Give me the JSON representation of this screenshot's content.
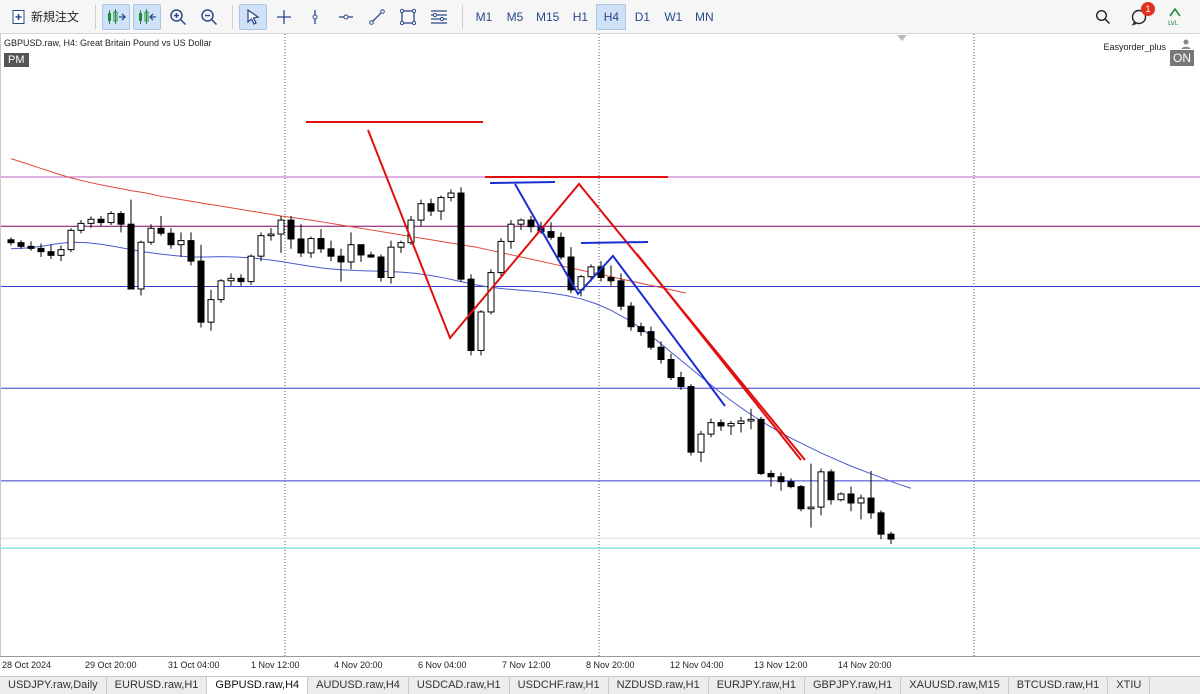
{
  "toolbar": {
    "new_order_label": "新規注文",
    "timeframes": [
      "M1",
      "M5",
      "M15",
      "H1",
      "H4",
      "D1",
      "W1",
      "MN"
    ],
    "active_timeframe": "H4",
    "notification_count": "1"
  },
  "chart": {
    "title": "GBPUSD.raw, H4:  Great Britain Pound vs US Dollar",
    "session_label": "PM",
    "ea_name": "Easyorder_plus",
    "ea_status": "ON",
    "ea_icon_text": "LVL"
  },
  "chart_data": {
    "type": "candlestick",
    "symbol": "GBPUSD.raw",
    "timeframe": "H4",
    "x_tick_labels": [
      "28 Oct 2024",
      "29 Oct 20:00",
      "31 Oct 04:00",
      "1 Nov 12:00",
      "4 Nov 20:00",
      "6 Nov 04:00",
      "7 Nov 12:00",
      "8 Nov 20:00",
      "12 Nov 04:00",
      "13 Nov 12:00",
      "14 Nov 20:00"
    ],
    "candles": [
      [
        0.742,
        0.748,
        0.728,
        0.735
      ],
      [
        0.735,
        0.741,
        0.72,
        0.726
      ],
      [
        0.726,
        0.738,
        0.715,
        0.721
      ],
      [
        0.721,
        0.733,
        0.7,
        0.713
      ],
      [
        0.713,
        0.73,
        0.695,
        0.704
      ],
      [
        0.704,
        0.728,
        0.69,
        0.718
      ],
      [
        0.718,
        0.77,
        0.712,
        0.765
      ],
      [
        0.765,
        0.79,
        0.758,
        0.782
      ],
      [
        0.782,
        0.799,
        0.771,
        0.792
      ],
      [
        0.792,
        0.8,
        0.775,
        0.784
      ],
      [
        0.784,
        0.812,
        0.778,
        0.806
      ],
      [
        0.806,
        0.812,
        0.76,
        0.78
      ],
      [
        0.78,
        0.84,
        0.622,
        0.622
      ],
      [
        0.622,
        0.74,
        0.606,
        0.736
      ],
      [
        0.736,
        0.78,
        0.73,
        0.77
      ],
      [
        0.77,
        0.8,
        0.752,
        0.758
      ],
      [
        0.758,
        0.77,
        0.72,
        0.73
      ],
      [
        0.73,
        0.76,
        0.7,
        0.74
      ],
      [
        0.74,
        0.76,
        0.68,
        0.69
      ],
      [
        0.69,
        0.73,
        0.528,
        0.541
      ],
      [
        0.541,
        0.62,
        0.52,
        0.596
      ],
      [
        0.596,
        0.646,
        0.588,
        0.642
      ],
      [
        0.642,
        0.66,
        0.63,
        0.648
      ],
      [
        0.648,
        0.658,
        0.63,
        0.64
      ],
      [
        0.64,
        0.706,
        0.632,
        0.702
      ],
      [
        0.702,
        0.76,
        0.69,
        0.752
      ],
      [
        0.752,
        0.77,
        0.74,
        0.756
      ],
      [
        0.756,
        0.8,
        0.71,
        0.79
      ],
      [
        0.79,
        0.8,
        0.72,
        0.744
      ],
      [
        0.744,
        0.78,
        0.7,
        0.71
      ],
      [
        0.71,
        0.75,
        0.698,
        0.745
      ],
      [
        0.745,
        0.768,
        0.71,
        0.72
      ],
      [
        0.72,
        0.74,
        0.69,
        0.702
      ],
      [
        0.702,
        0.72,
        0.64,
        0.688
      ],
      [
        0.688,
        0.76,
        0.67,
        0.73
      ],
      [
        0.73,
        0.73,
        0.688,
        0.705
      ],
      [
        0.705,
        0.713,
        0.698,
        0.7
      ],
      [
        0.7,
        0.706,
        0.64,
        0.65
      ],
      [
        0.65,
        0.74,
        0.635,
        0.724
      ],
      [
        0.724,
        0.74,
        0.71,
        0.735
      ],
      [
        0.735,
        0.8,
        0.73,
        0.79
      ],
      [
        0.79,
        0.84,
        0.775,
        0.83
      ],
      [
        0.83,
        0.842,
        0.8,
        0.812
      ],
      [
        0.812,
        0.85,
        0.79,
        0.845
      ],
      [
        0.845,
        0.865,
        0.836,
        0.856
      ],
      [
        0.856,
        0.87,
        0.64,
        0.646
      ],
      [
        0.646,
        0.658,
        0.46,
        0.472
      ],
      [
        0.472,
        0.57,
        0.46,
        0.566
      ],
      [
        0.566,
        0.67,
        0.56,
        0.662
      ],
      [
        0.662,
        0.746,
        0.65,
        0.738
      ],
      [
        0.738,
        0.79,
        0.72,
        0.78
      ],
      [
        0.78,
        0.794,
        0.766,
        0.79
      ],
      [
        0.79,
        0.8,
        0.76,
        0.774
      ],
      [
        0.774,
        0.786,
        0.756,
        0.762
      ],
      [
        0.762,
        0.785,
        0.742,
        0.748
      ],
      [
        0.748,
        0.76,
        0.694,
        0.7
      ],
      [
        0.7,
        0.724,
        0.612,
        0.62
      ],
      [
        0.62,
        0.656,
        0.604,
        0.652
      ],
      [
        0.652,
        0.682,
        0.64,
        0.676
      ],
      [
        0.676,
        0.69,
        0.64,
        0.65
      ],
      [
        0.65,
        0.68,
        0.63,
        0.642
      ],
      [
        0.642,
        0.66,
        0.57,
        0.58
      ],
      [
        0.58,
        0.59,
        0.52,
        0.53
      ],
      [
        0.53,
        0.54,
        0.508,
        0.518
      ],
      [
        0.518,
        0.53,
        0.474,
        0.48
      ],
      [
        0.48,
        0.494,
        0.44,
        0.45
      ],
      [
        0.45,
        0.464,
        0.4,
        0.406
      ],
      [
        0.406,
        0.42,
        0.376,
        0.384
      ],
      [
        0.384,
        0.39,
        0.216,
        0.224
      ],
      [
        0.224,
        0.276,
        0.2,
        0.268
      ],
      [
        0.268,
        0.306,
        0.26,
        0.296
      ],
      [
        0.296,
        0.304,
        0.276,
        0.288
      ],
      [
        0.288,
        0.3,
        0.266,
        0.294
      ],
      [
        0.294,
        0.31,
        0.272,
        0.3
      ],
      [
        0.3,
        0.33,
        0.28,
        0.304
      ],
      [
        0.304,
        0.31,
        0.168,
        0.172
      ],
      [
        0.172,
        0.18,
        0.14,
        0.164
      ],
      [
        0.164,
        0.174,
        0.13,
        0.152
      ],
      [
        0.152,
        0.16,
        0.136,
        0.14
      ],
      [
        0.14,
        0.144,
        0.08,
        0.086
      ],
      [
        0.086,
        0.196,
        0.04,
        0.09
      ],
      [
        0.09,
        0.184,
        0.07,
        0.176
      ],
      [
        0.176,
        0.182,
        0.096,
        0.108
      ],
      [
        0.108,
        0.126,
        0.104,
        0.122
      ],
      [
        0.122,
        0.14,
        0.08,
        0.1
      ],
      [
        0.1,
        0.12,
        0.06,
        0.112
      ],
      [
        0.112,
        0.178,
        0.062,
        0.076
      ],
      [
        0.076,
        0.082,
        0.012,
        0.024
      ],
      [
        0.024,
        0.03,
        0.0,
        0.012
      ]
    ],
    "horizontal_levels": [
      {
        "value": 0.895,
        "color": "#c060c0"
      },
      {
        "value": 0.775,
        "color": "#800060"
      },
      {
        "value": 0.628,
        "color": "#3a3ad0"
      },
      {
        "value": 0.38,
        "color": "#3a3ad0"
      },
      {
        "value": 0.154,
        "color": "#3a3ad0"
      },
      {
        "value": 0.014,
        "color": "#dcdcdc"
      },
      {
        "value": -0.01,
        "color": "#4fd4e0"
      }
    ],
    "moving_averages": [
      {
        "color": "#e0483c",
        "values": [
          0.94,
          0.928,
          0.916,
          0.904,
          0.893,
          0.884,
          0.876,
          0.869,
          0.862,
          0.856,
          0.848,
          0.842,
          0.836,
          0.83,
          0.824,
          0.818,
          0.812,
          0.806,
          0.8,
          0.795,
          0.79,
          0.784,
          0.778,
          0.772,
          0.766,
          0.76,
          0.754,
          0.748,
          0.742,
          0.736,
          0.73,
          0.724,
          0.716,
          0.708,
          0.7,
          0.692,
          0.684,
          0.676,
          0.668,
          0.66,
          0.652,
          0.644,
          0.636,
          0.628,
          0.62,
          0.612
        ]
      },
      {
        "color": "#4a5ad0",
        "values": [
          0.72,
          0.722,
          0.726,
          0.732,
          0.736,
          0.735,
          0.731,
          0.725,
          0.718,
          0.712,
          0.707,
          0.703,
          0.7,
          0.7,
          0.701,
          0.7,
          0.698,
          0.694,
          0.689,
          0.683,
          0.677,
          0.672,
          0.669,
          0.667,
          0.666,
          0.665,
          0.663,
          0.66,
          0.655,
          0.648,
          0.64,
          0.632,
          0.626,
          0.622,
          0.619,
          0.616,
          0.612,
          0.606,
          0.598,
          0.586,
          0.57,
          0.55,
          0.526,
          0.498,
          0.468,
          0.438,
          0.408,
          0.378,
          0.35,
          0.324,
          0.3,
          0.278,
          0.258,
          0.24,
          0.222,
          0.206,
          0.19,
          0.176,
          0.162,
          0.148,
          0.136
        ]
      }
    ]
  },
  "tabs": [
    {
      "label": "USDJPY.raw,Daily",
      "active": false
    },
    {
      "label": "EURUSD.raw,H1",
      "active": false
    },
    {
      "label": "GBPUSD.raw,H4",
      "active": true
    },
    {
      "label": "AUDUSD.raw,H4",
      "active": false
    },
    {
      "label": "USDCAD.raw,H1",
      "active": false
    },
    {
      "label": "USDCHF.raw,H1",
      "active": false
    },
    {
      "label": "NZDUSD.raw,H1",
      "active": false
    },
    {
      "label": "EURJPY.raw,H1",
      "active": false
    },
    {
      "label": "GBPJPY.raw,H1",
      "active": false
    },
    {
      "label": "XAUUSD.raw,M15",
      "active": false
    },
    {
      "label": "BTCUSD.raw,H1",
      "active": false
    },
    {
      "label": "XTIU",
      "active": false
    }
  ]
}
